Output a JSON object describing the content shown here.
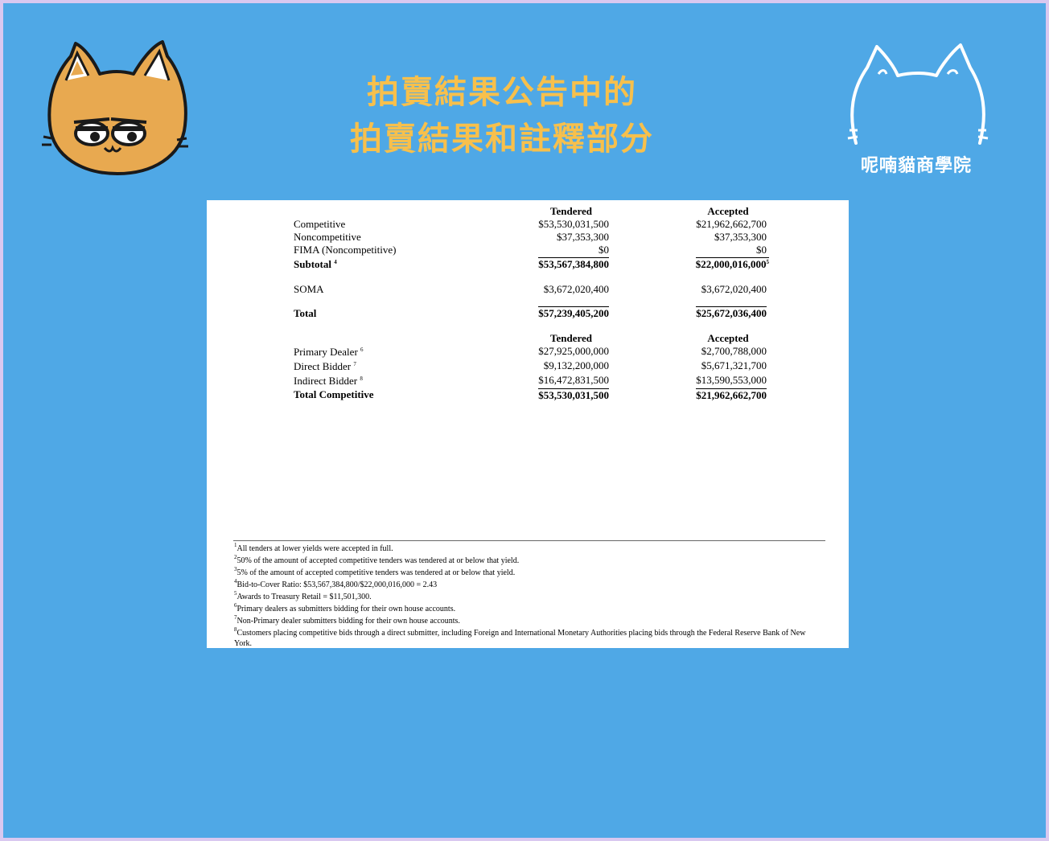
{
  "header": {
    "title_line1": "拍賣結果公告中的",
    "title_line2": "拍賣結果和註釋部分",
    "brand": "呢喃貓商學院"
  },
  "colors": {
    "background": "#4fa8e6",
    "title": "#f7c04c",
    "cat_fill": "#e8a950",
    "frame_border": "#d9c8f0"
  },
  "icons": {
    "left": "orange-cat-face-icon",
    "right": "white-cat-outline-icon"
  },
  "table1": {
    "col_tendered": "Tendered",
    "col_accepted": "Accepted",
    "rows": [
      {
        "label": "Competitive",
        "tendered": "$53,530,031,500",
        "accepted": "$21,962,662,700"
      },
      {
        "label": "Noncompetitive",
        "tendered": "$37,353,300",
        "accepted": "$37,353,300"
      },
      {
        "label": "FIMA (Noncompetitive)",
        "tendered": "$0",
        "accepted": "$0"
      }
    ],
    "subtotal": {
      "label": "Subtotal",
      "note": "4",
      "tendered": "$53,567,384,800",
      "accepted": "$22,000,016,000",
      "accepted_note": "5"
    },
    "soma": {
      "label": "SOMA",
      "tendered": "$3,672,020,400",
      "accepted": "$3,672,020,400"
    },
    "total": {
      "label": "Total",
      "tendered": "$57,239,405,200",
      "accepted": "$25,672,036,400"
    }
  },
  "table2": {
    "col_tendered": "Tendered",
    "col_accepted": "Accepted",
    "rows": [
      {
        "label": "Primary Dealer",
        "note": "6",
        "tendered": "$27,925,000,000",
        "accepted": "$2,700,788,000"
      },
      {
        "label": "Direct Bidder",
        "note": "7",
        "tendered": "$9,132,200,000",
        "accepted": "$5,671,321,700"
      },
      {
        "label": "Indirect Bidder",
        "note": "8",
        "tendered": "$16,472,831,500",
        "accepted": "$13,590,553,000"
      }
    ],
    "total": {
      "label": "Total Competitive",
      "tendered": "$53,530,031,500",
      "accepted": "$21,962,662,700"
    }
  },
  "footnotes": [
    {
      "num": "1",
      "text": "All tenders at lower yields were accepted in full."
    },
    {
      "num": "2",
      "text": "50% of the amount of accepted competitive tenders was tendered at or below that yield."
    },
    {
      "num": "3",
      "text": "5% of the amount of accepted competitive tenders was tendered at or below that yield."
    },
    {
      "num": "4",
      "text": "Bid-to-Cover Ratio: $53,567,384,800/$22,000,016,000 = 2.43"
    },
    {
      "num": "5",
      "text": "Awards to Treasury Retail = $11,501,300."
    },
    {
      "num": "6",
      "text": "Primary dealers as submitters bidding for their own house accounts."
    },
    {
      "num": "7",
      "text": "Non-Primary dealer submitters bidding for their own house accounts."
    },
    {
      "num": "8",
      "text": "Customers placing competitive bids through a direct submitter, including Foreign and International Monetary Authorities placing bids through the Federal Reserve Bank of New York."
    }
  ]
}
